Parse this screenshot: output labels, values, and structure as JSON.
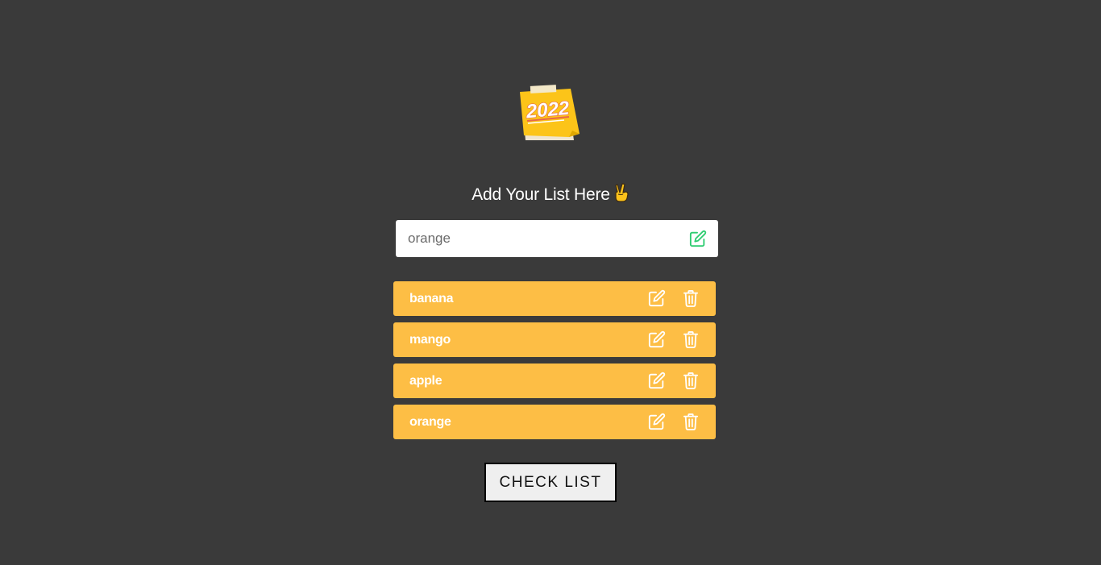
{
  "logo": {
    "icon": "sticky-note-2022-logo",
    "text": "2022",
    "colors": {
      "note": "#fcc419",
      "paper": "#efe5cf",
      "tape": "#f3e8c8",
      "text_stroke": "#e8684a"
    }
  },
  "heading": {
    "text": "Add Your List Here",
    "emoji": "✌️"
  },
  "input": {
    "value": "orange",
    "placeholder": "",
    "icon": "add-edit-icon",
    "icon_color": "#2ecc71"
  },
  "items": [
    {
      "label": "banana",
      "edit_icon": "edit-icon",
      "delete_icon": "trash-icon"
    },
    {
      "label": "mango",
      "edit_icon": "edit-icon",
      "delete_icon": "trash-icon"
    },
    {
      "label": "apple",
      "edit_icon": "edit-icon",
      "delete_icon": "trash-icon"
    },
    {
      "label": "orange",
      "edit_icon": "edit-icon",
      "delete_icon": "trash-icon"
    }
  ],
  "check_button": {
    "label": "CHECK LIST"
  },
  "colors": {
    "background": "#3a3a3a",
    "item_bg": "#fdbe45",
    "item_text": "#ffffff",
    "button_bg": "#efefef"
  }
}
